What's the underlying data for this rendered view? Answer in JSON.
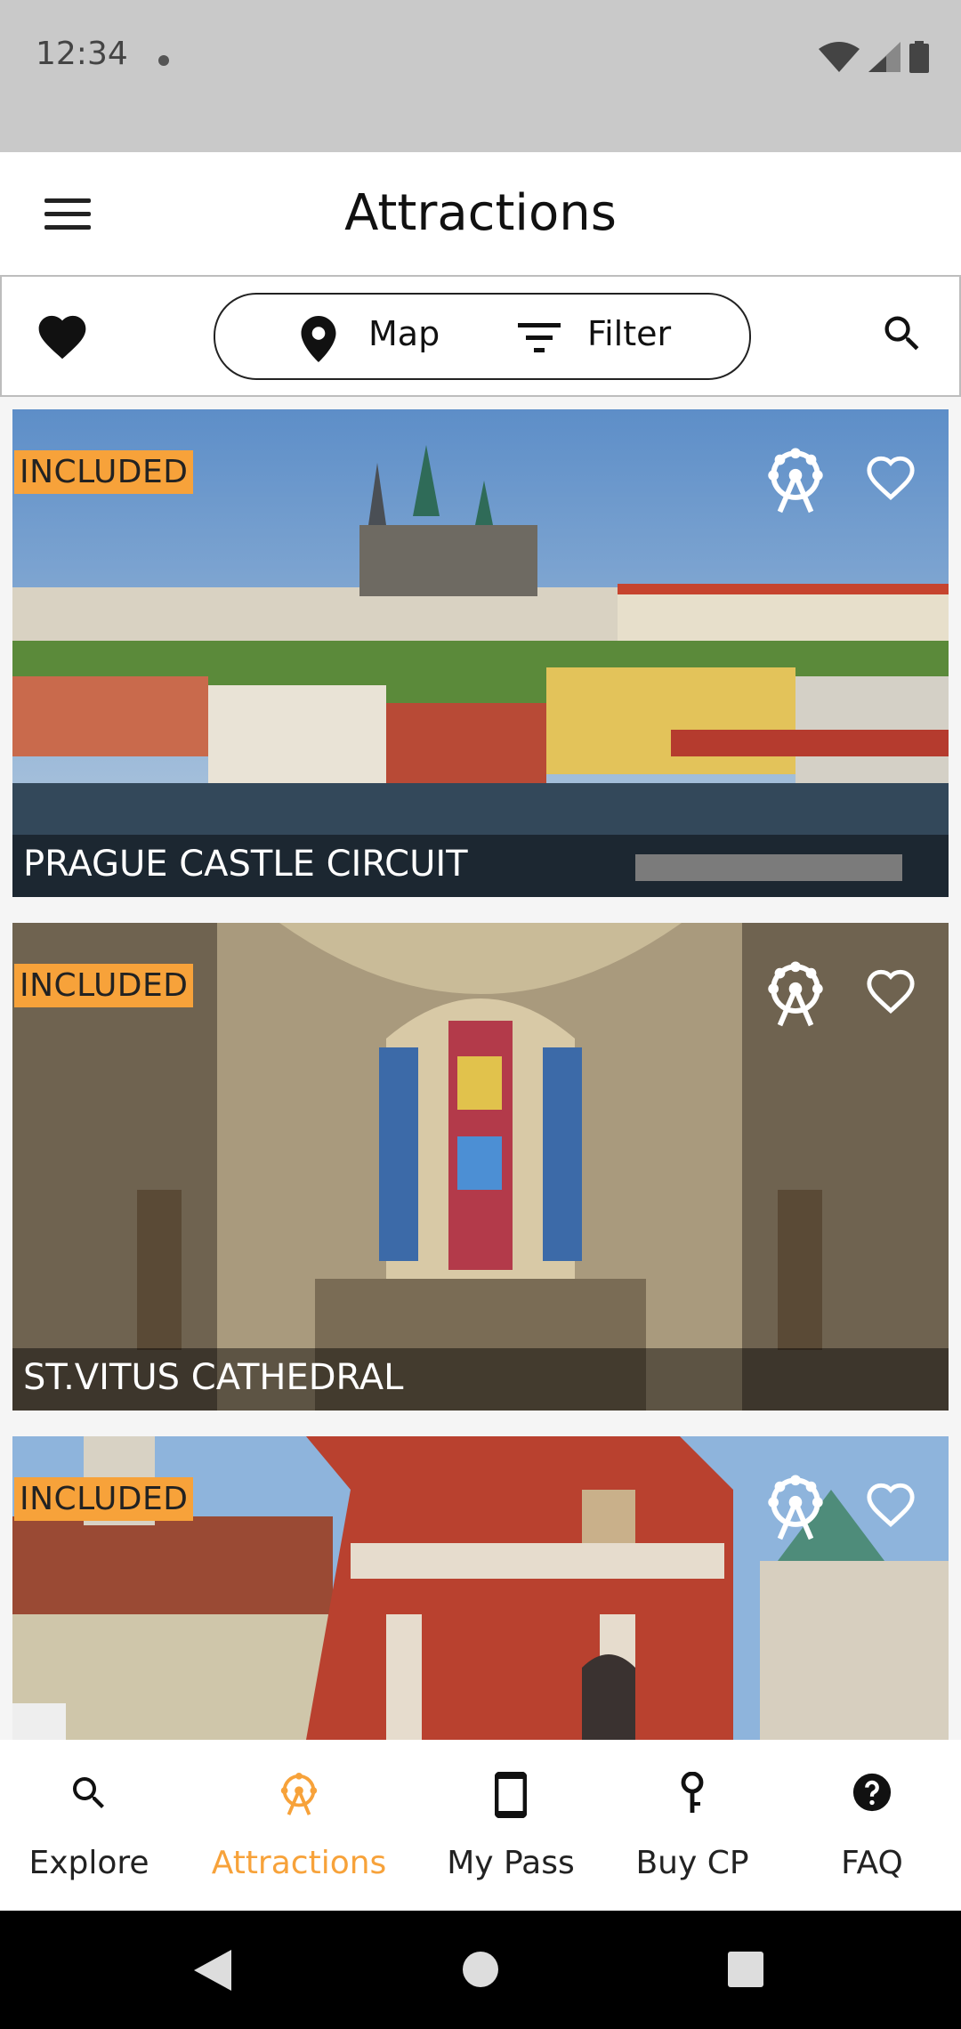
{
  "status_bar": {
    "time": "12:34",
    "icons": [
      "wifi-icon",
      "signal-icon",
      "battery-icon"
    ]
  },
  "app_bar": {
    "title": "Attractions",
    "menu_icon": "hamburger-menu-icon"
  },
  "toolbar": {
    "map_label": "Map",
    "filter_label": "Filter"
  },
  "colors": {
    "accent": "#f7a23a",
    "badge_text": "#222222"
  },
  "attractions": [
    {
      "badge": "INCLUDED",
      "name": "PRAGUE CASTLE CIRCUIT"
    },
    {
      "badge": "INCLUDED",
      "name": "ST.VITUS CATHEDRAL"
    },
    {
      "badge": "INCLUDED",
      "name": ""
    }
  ],
  "bottom_nav": [
    {
      "label": "Explore",
      "icon": "search-icon",
      "active": false
    },
    {
      "label": "Attractions",
      "icon": "attractions-icon",
      "active": true
    },
    {
      "label": "My Pass",
      "icon": "phone-icon",
      "active": false
    },
    {
      "label": "Buy CP",
      "icon": "key-icon",
      "active": false
    },
    {
      "label": "FAQ",
      "icon": "help-icon",
      "active": false
    }
  ]
}
